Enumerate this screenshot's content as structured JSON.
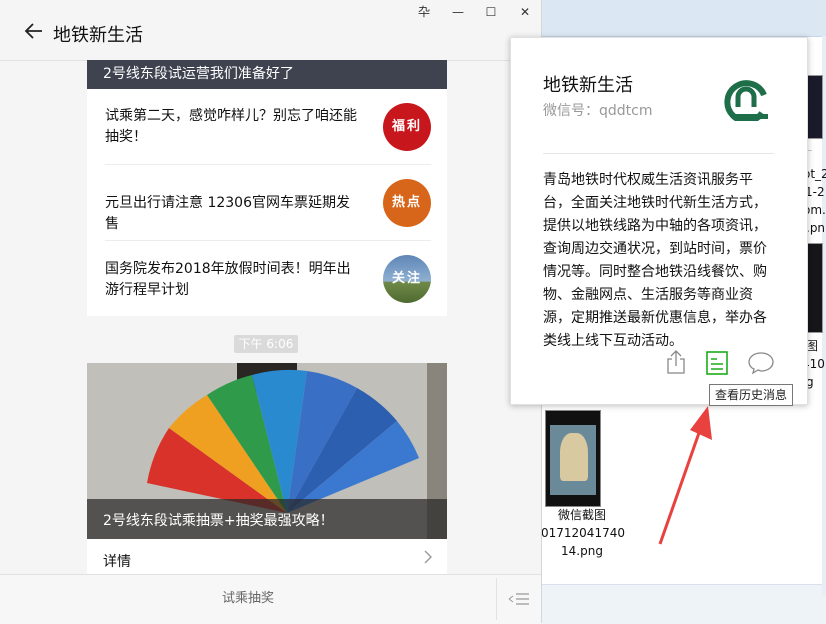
{
  "window": {
    "title": "地铁新生活",
    "controls": {
      "pin": "卆",
      "minimize": "—",
      "maximize": "☐",
      "close": "✕"
    }
  },
  "feed": {
    "top_banner_title": "2号线东段试运营我们准备好了",
    "articles": [
      {
        "title": "试乘第二天，感觉咋样儿？别忘了咱还能抽奖！",
        "thumb_label": "福利",
        "thumb_color": "#c8161d"
      },
      {
        "title": "元旦出行请注意 12306官网车票延期发售",
        "thumb_label": "热点",
        "thumb_color": "#d8661a"
      },
      {
        "title": "国务院发布2018年放假时间表！明年出游行程早计划",
        "thumb_label": "关注",
        "thumb_color": "#6e8fb5"
      }
    ],
    "timestamp": "下午 6:06",
    "photo_article": {
      "title": "2号线东段试乘抽票+抽奖最强攻略！",
      "detail_label": "详情"
    }
  },
  "menu": {
    "item_label": "试乘抽奖"
  },
  "profile": {
    "name": "地铁新生活",
    "wechat_id": "微信号：qddtcm",
    "logo_color": "#1f6e4a",
    "description": "青岛地铁时代权威生活资讯服务平台，全面关注地铁时代新生活方式，提供以地铁线路为中轴的各项资讯，查询周边交通状况，到站时间，票价情况等。同时整合地铁沿线餐饮、购物、金融网点、生活服务等商业资源，定期推送最新优惠信息，举办各类线上线下互动活动。",
    "history_tooltip": "查看历史消息",
    "history_icon_color": "#1aad19"
  },
  "desktop": {
    "files": [
      {
        "name": "微信截图\n01712041740\n14.png"
      }
    ],
    "partial_labels": [
      "ot_2",
      "1-2",
      "om.t",
      ".pn",
      "图",
      "410",
      "g"
    ]
  },
  "accent_color": "#e8413e"
}
